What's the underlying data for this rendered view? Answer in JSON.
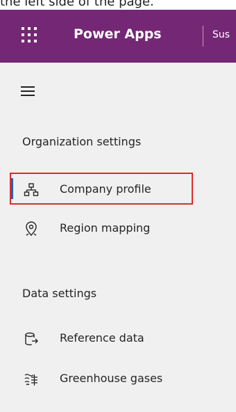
{
  "caption": "the left side of the page.",
  "header": {
    "app_title": "Power Apps",
    "environment_truncated": "Sus"
  },
  "sidebar": {
    "sections": [
      {
        "title": "Organization settings",
        "items": [
          {
            "label": "Company profile",
            "icon": "org-chart-icon",
            "selected": true
          },
          {
            "label": "Region mapping",
            "icon": "map-pin-icon",
            "selected": false
          }
        ]
      },
      {
        "title": "Data settings",
        "items": [
          {
            "label": "Reference data",
            "icon": "database-arrow-icon",
            "selected": false
          },
          {
            "label": "Greenhouse gases",
            "icon": "greenhouse-gas-icon",
            "selected": false
          }
        ]
      }
    ]
  },
  "colors": {
    "topbar": "#742774",
    "selection_outline": "#e0282c",
    "selection_bar": "#0f6cbd",
    "nav_background": "#f0f0f0"
  }
}
